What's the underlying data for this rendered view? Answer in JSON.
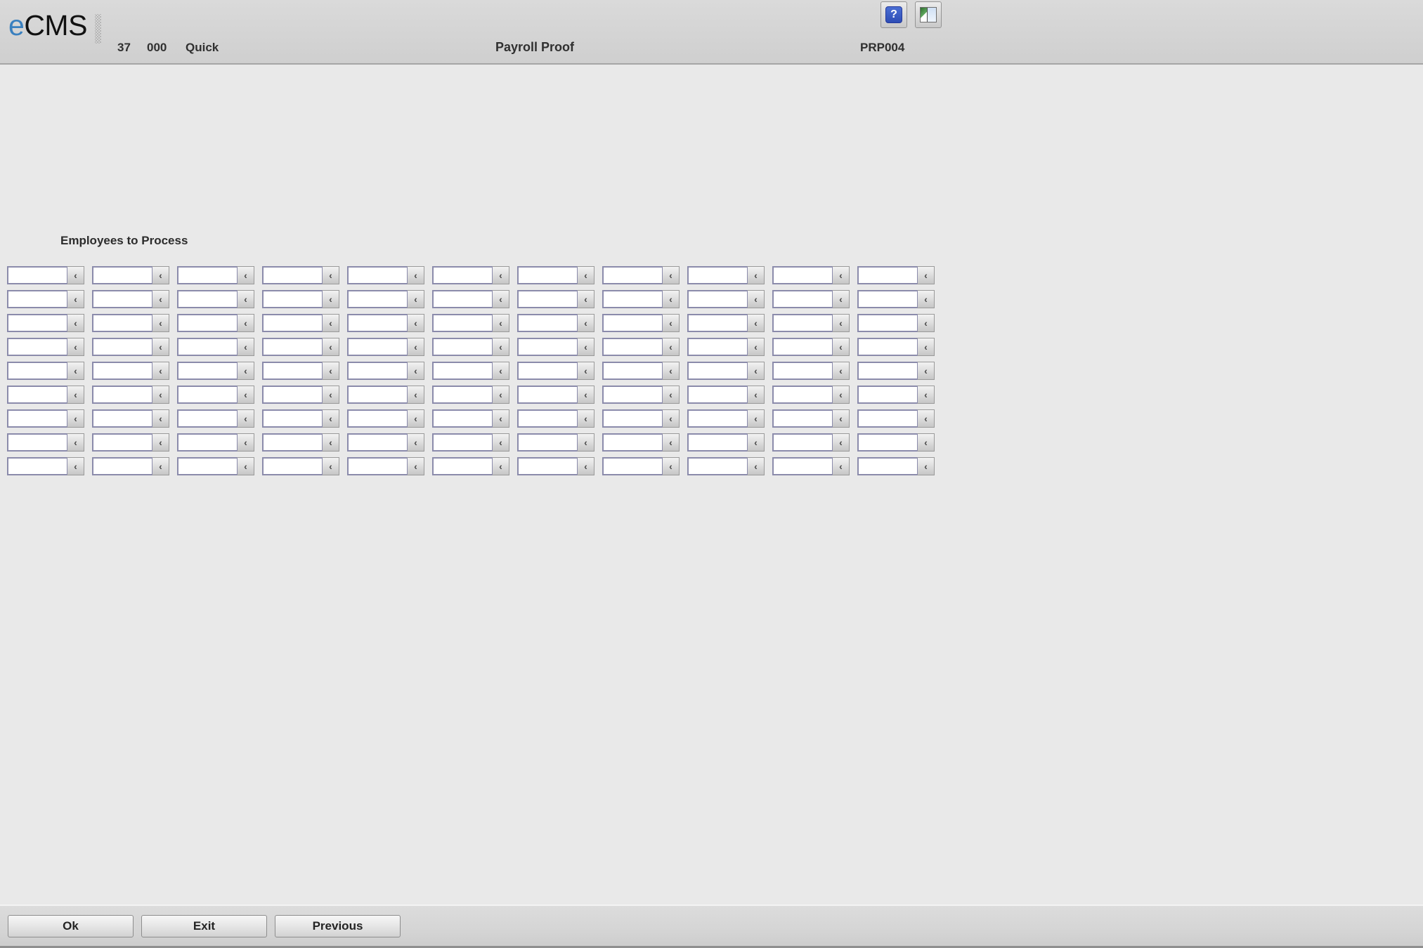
{
  "header": {
    "logo": {
      "prefix": "e",
      "suffix": "CMS",
      "grip_icon": "drag-grip-icon"
    },
    "company_number": "37",
    "division_number": "000",
    "mode": "Quick",
    "screen_title": "Payroll Proof",
    "program_id": "PRP004",
    "icons": [
      {
        "name": "help-icon",
        "glyph": "?",
        "tooltip": "Help"
      },
      {
        "name": "window-split-icon",
        "glyph": "",
        "tooltip": "Window"
      }
    ]
  },
  "main": {
    "section_label": "Employees to Process",
    "grid": {
      "columns": 11,
      "rows": 9,
      "total_fields": 99,
      "lookup_glyph": "‹",
      "lookup_icon_name": "lookup-chevron-icon",
      "field_placeholder": "",
      "field_values": [
        "",
        "",
        "",
        "",
        "",
        "",
        "",
        "",
        "",
        "",
        "",
        "",
        "",
        "",
        "",
        "",
        "",
        "",
        "",
        "",
        "",
        "",
        "",
        "",
        "",
        "",
        "",
        "",
        "",
        "",
        "",
        "",
        "",
        "",
        "",
        "",
        "",
        "",
        "",
        "",
        "",
        "",
        "",
        "",
        "",
        "",
        "",
        "",
        "",
        "",
        "",
        "",
        "",
        "",
        "",
        "",
        "",
        "",
        "",
        "",
        "",
        "",
        "",
        "",
        "",
        "",
        "",
        "",
        "",
        "",
        "",
        "",
        "",
        "",
        "",
        "",
        "",
        "",
        "",
        "",
        "",
        "",
        "",
        "",
        "",
        "",
        "",
        "",
        "",
        "",
        "",
        "",
        "",
        "",
        "",
        "",
        "",
        "",
        ""
      ]
    }
  },
  "footer": {
    "buttons": [
      {
        "name": "ok-button",
        "label": "Ok"
      },
      {
        "name": "exit-button",
        "label": "Exit"
      },
      {
        "name": "previous-button",
        "label": "Previous"
      }
    ]
  },
  "colors": {
    "header_bg": "#d4d4d4",
    "body_bg": "#e9e9e9",
    "footer_bg": "#d5d5d5",
    "logo_accent": "#3a80bf",
    "field_border": "#8b8bab",
    "help_icon_blue": "#2e4db5"
  }
}
